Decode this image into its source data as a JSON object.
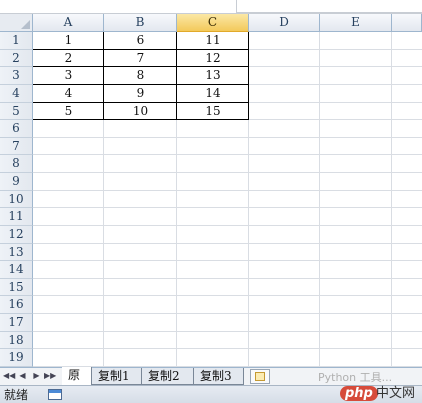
{
  "columns": [
    "A",
    "B",
    "C",
    "D",
    "E"
  ],
  "rows": [
    "1",
    "2",
    "3",
    "4",
    "5",
    "6",
    "7",
    "8",
    "9",
    "10",
    "11",
    "12",
    "13",
    "14",
    "15",
    "16",
    "17",
    "18",
    "19"
  ],
  "cells": [
    [
      "1",
      "6",
      "11"
    ],
    [
      "2",
      "7",
      "12"
    ],
    [
      "3",
      "8",
      "13"
    ],
    [
      "4",
      "9",
      "14"
    ],
    [
      "5",
      "10",
      "15"
    ]
  ],
  "sheet_tabs": [
    "原",
    "复制1",
    "复制2",
    "复制3"
  ],
  "active_tab": "原",
  "status": {
    "text": "就绪"
  },
  "nav_buttons": [
    "◀◀",
    "◀",
    "▶",
    "▶▶"
  ],
  "watermark": {
    "logo": "php",
    "site": "中文网",
    "overlay": "Python 工具..."
  },
  "colors": {
    "selected_header": "#f3c95b",
    "header_bg": "#e3e8ef",
    "gridline": "#d9dde3"
  },
  "icons": {
    "new_sheet": "insert-worksheet-icon",
    "status_layout": "normal-view-icon"
  }
}
